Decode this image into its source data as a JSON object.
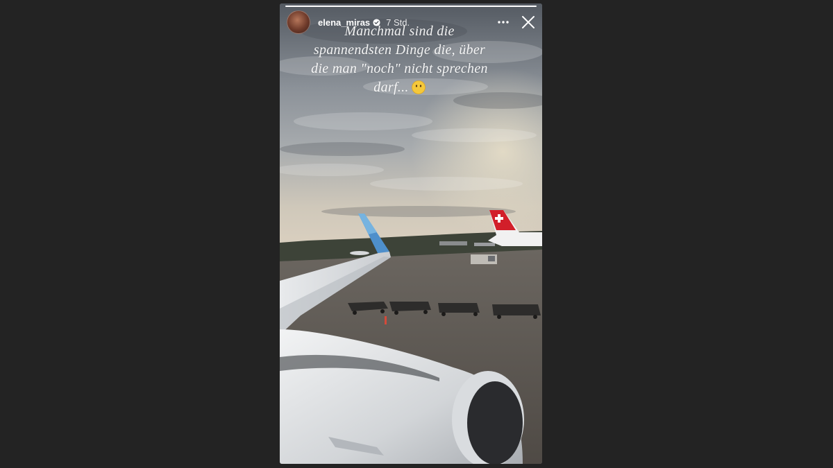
{
  "story": {
    "username": "elena_miras",
    "time_ago": "7 Std.",
    "verified": true,
    "progress": 1.0,
    "caption_lines": [
      "Manchmal sind die",
      "spannendsten Dinge die, über",
      "die man \"noch\" nicht sprechen",
      "darf..."
    ],
    "caption_emoji": "neutral-face-emoji",
    "icons": {
      "more": "more-horizontal-icon",
      "close": "close-icon",
      "verified": "verified-badge-icon"
    }
  },
  "colors": {
    "page_background": "#232323",
    "verified_blue": "#ffffff",
    "emoji_yellow": "#f5c83a"
  }
}
